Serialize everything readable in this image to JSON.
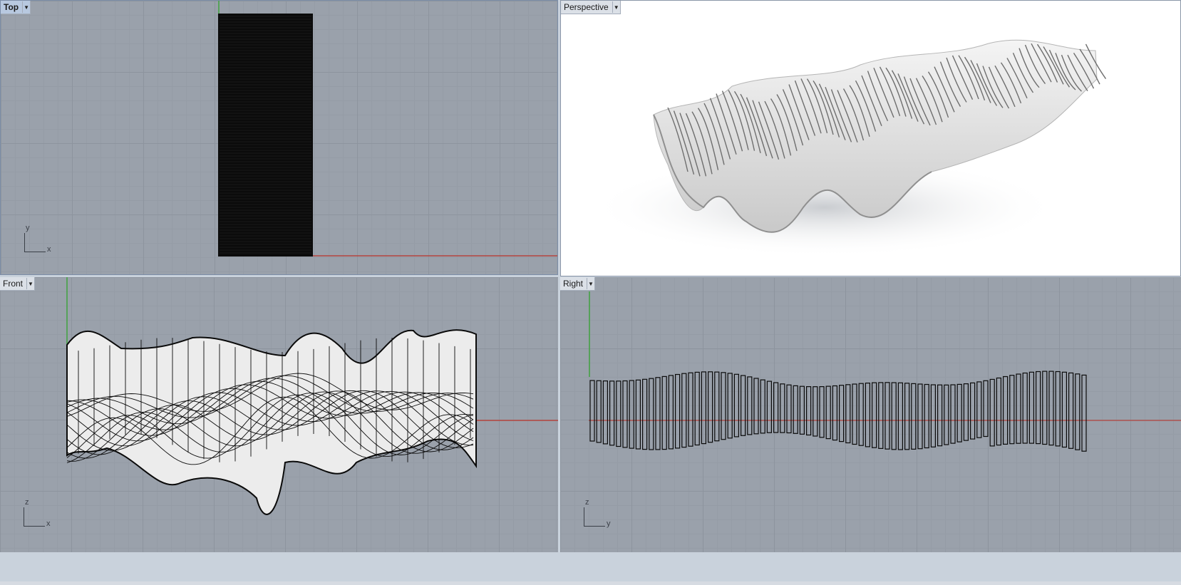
{
  "viewports": {
    "top": {
      "label": "Top",
      "axis_h": "x",
      "axis_v": "y"
    },
    "perspective": {
      "label": "Perspective"
    },
    "front": {
      "label": "Front",
      "axis_h": "x",
      "axis_v": "z"
    },
    "right": {
      "label": "Right",
      "axis_h": "y",
      "axis_v": "z"
    }
  },
  "icons": {
    "dropdown": "chevron-down-icon"
  },
  "colors": {
    "viewport_bg": "#9aa1ab",
    "x_axis": "#b5453f",
    "y_axis": "#3fa23f",
    "active_tab": "#b8c9e0"
  }
}
